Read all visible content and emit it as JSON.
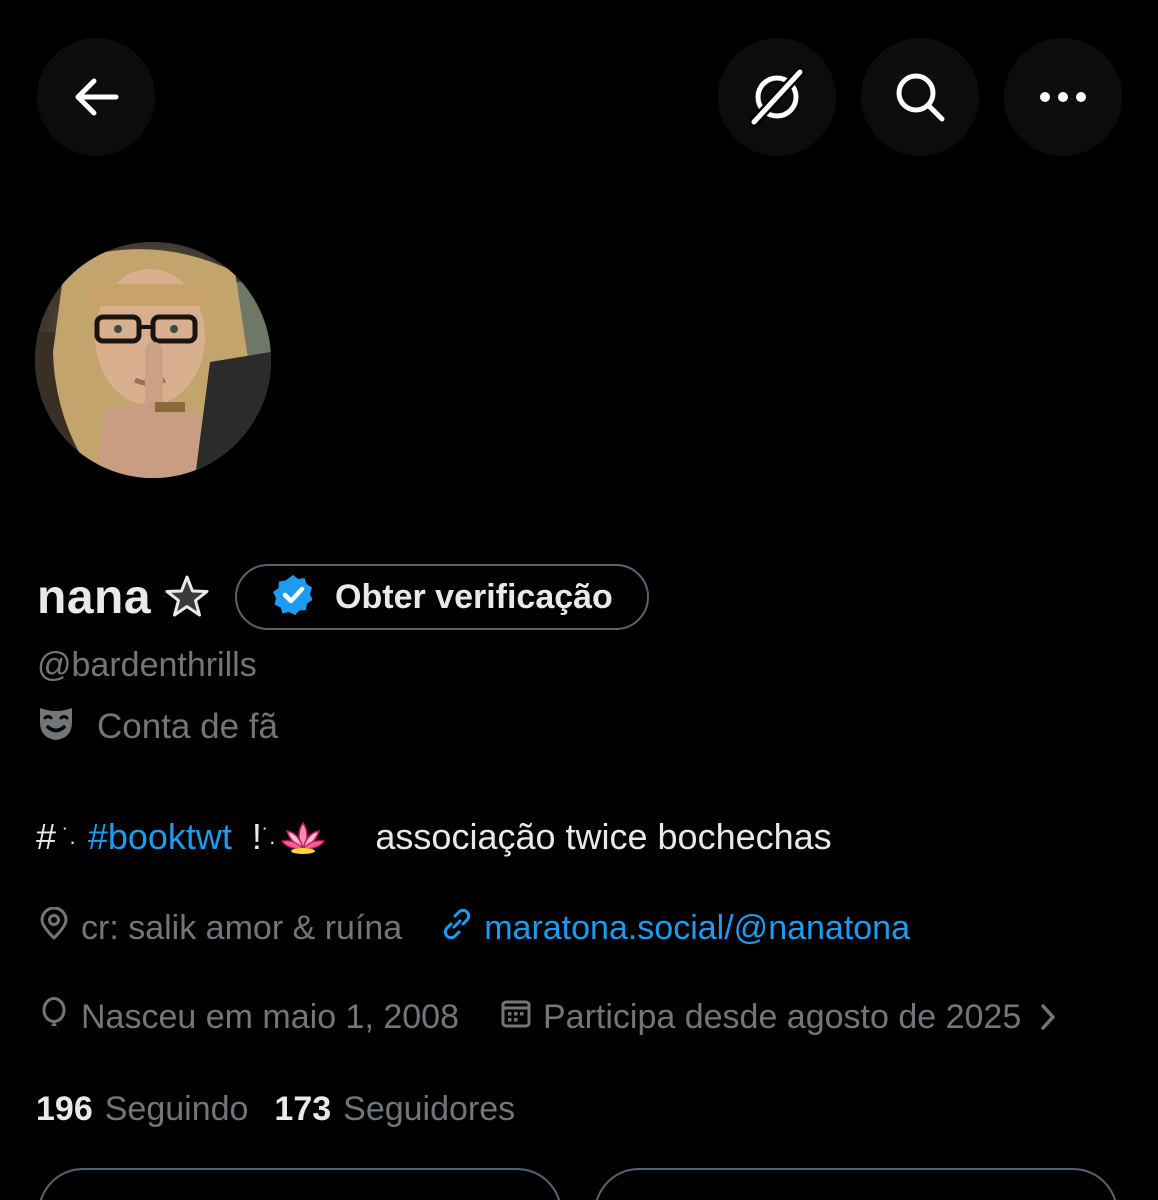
{
  "header": {
    "back_icon": "arrow-left-icon",
    "grok_icon": "grok-icon",
    "search_icon": "search-icon",
    "more_icon": "more-horizontal-icon"
  },
  "profile": {
    "display_name": "nana",
    "name_emoji": "star-emoji",
    "verify_button_label": "Obter verificação",
    "handle": "@bardenthrills",
    "category_icon": "performing-arts-mask-icon",
    "category": "Conta de fã",
    "bio": {
      "prefix": "#",
      "hashtag": "#booktwt",
      "exclamation": "!",
      "emoji": "lotus-emoji",
      "text": "associação twice bochechas"
    },
    "location": "cr: salik amor & ruína",
    "website": "maratona.social/@nanatona",
    "birthday": "Nasceu em maio 1, 2008",
    "joined": "Participa desde agosto de 2025",
    "following_count": "196",
    "following_label": "Seguindo",
    "followers_count": "173",
    "followers_label": "Seguidores"
  },
  "colors": {
    "background": "#000000",
    "text_primary": "#e7e9ea",
    "text_secondary": "#71767b",
    "accent": "#1d9bf0",
    "border": "#536471"
  }
}
